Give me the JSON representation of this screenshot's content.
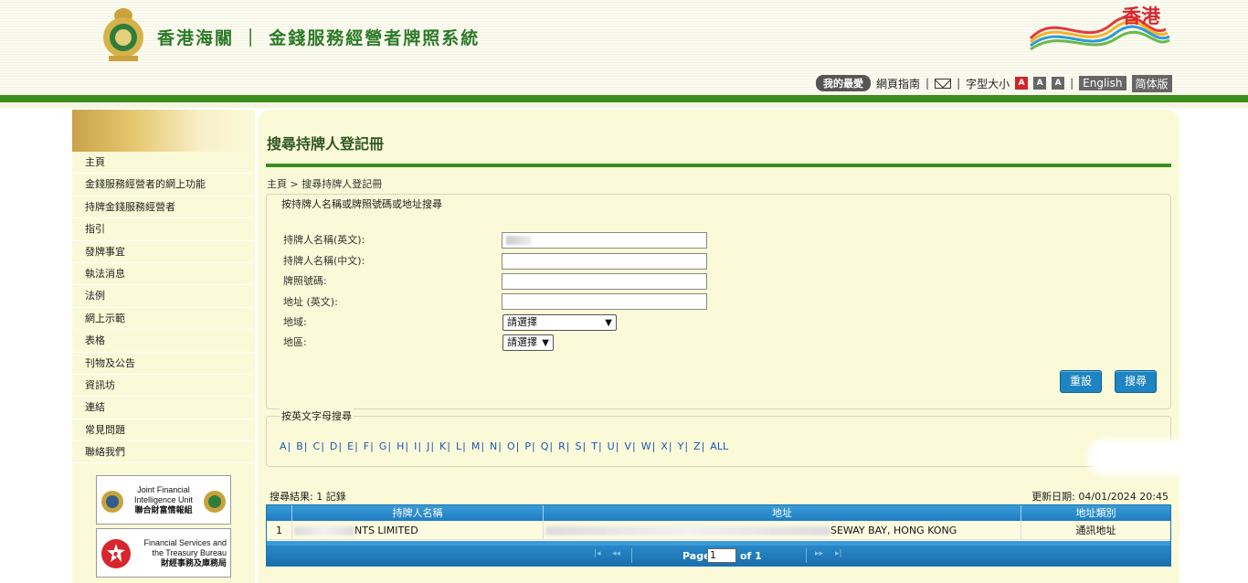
{
  "header": {
    "site_title": "香港海關 ｜ 金錢服務經營者牌照系統",
    "brand_logo_text": "香港",
    "favorites": "我的最愛",
    "sitemap": "網頁指南",
    "font_size_label": "字型大小",
    "font_sizes": [
      "A",
      "A",
      "A"
    ],
    "lang_en": "English",
    "lang_sc": "简体版",
    "colors": {
      "green": "#3b8e1c",
      "title_green": "#2c7a28"
    }
  },
  "sidebar": {
    "items": [
      "主頁",
      "金錢服務經營者的網上功能",
      "持牌金錢服務經營者",
      "指引",
      "發牌事宜",
      "執法消息",
      "法例",
      "網上示範",
      "表格",
      "刊物及公告",
      "資訊坊",
      "連結",
      "常見問題",
      "聯絡我們"
    ],
    "logo1": {
      "line1": "Joint Financial",
      "line2": "Intelligence Unit",
      "line3": "聯合財富情報組"
    },
    "logo2": {
      "line1": "Financial Services and",
      "line2": "the Treasury Bureau",
      "line3": "財經事務及庫務局"
    }
  },
  "main": {
    "page_title": "搜尋持牌人登記冊",
    "breadcrumb": "主頁 > 搜尋持牌人登記冊",
    "search_legend": "按持牌人名稱或牌照號碼或地址搜尋",
    "fields": {
      "name_en": "持牌人名稱(英文):",
      "name_zh": "持牌人名稱(中文):",
      "licence_no": "牌照號碼:",
      "address_en": "地址 (英文):",
      "region": "地域:",
      "district": "地區:"
    },
    "region_selected": "請選擇",
    "district_selected": "請選擇",
    "reset_button": "重設",
    "search_button": "搜尋",
    "alpha_legend": "按英文字母搜尋",
    "letters": [
      "A",
      "B",
      "C",
      "D",
      "E",
      "F",
      "G",
      "H",
      "I",
      "J",
      "K",
      "L",
      "M",
      "N",
      "O",
      "P",
      "Q",
      "R",
      "S",
      "T",
      "U",
      "V",
      "W",
      "X",
      "Y",
      "Z",
      "ALL"
    ],
    "result_count": "搜尋結果: 1 記錄",
    "update_date": "更新日期: 04/01/2024 20:45",
    "table": {
      "headers": [
        "持牌人名稱",
        "地址",
        "地址類別"
      ],
      "rows": [
        {
          "index": "1",
          "name": "NTS LIMITED",
          "address": "SEWAY BAY, HONG KONG",
          "type": "通訊地址"
        }
      ]
    },
    "pager": {
      "page_label": "Page",
      "page_value": "1",
      "of_label": "of 1",
      "first": "|◂",
      "prev": "◂◂",
      "next": "▸▸",
      "last": "▸|"
    }
  }
}
